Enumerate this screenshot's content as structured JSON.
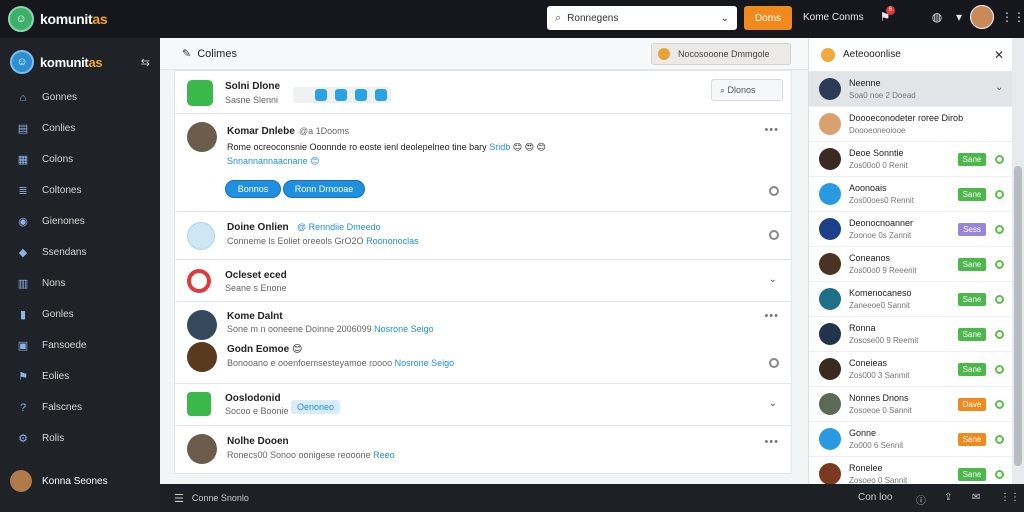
{
  "app": {
    "brand_main": "komunit",
    "brand_accent": "as",
    "side_brand_main": "komunit",
    "side_brand_accent": "as"
  },
  "topbar": {
    "search_value": "Ronnegens",
    "cta_label": "Doms",
    "link_label": "Kome Conms",
    "notif_count": "6"
  },
  "sidebar": {
    "items": [
      {
        "label": "Gonnes",
        "icon": "home-icon"
      },
      {
        "label": "Conlies",
        "icon": "folder-icon"
      },
      {
        "label": "Colons",
        "icon": "grid-icon"
      },
      {
        "label": "Coltones",
        "icon": "list-icon"
      },
      {
        "label": "Gienones",
        "icon": "globe-icon"
      },
      {
        "label": "Ssendans",
        "icon": "drop-icon"
      },
      {
        "label": "Nons",
        "icon": "book-icon"
      },
      {
        "label": "Gonles",
        "icon": "chart-icon"
      },
      {
        "label": "Fansoede",
        "icon": "calendar-icon"
      },
      {
        "label": "Eolies",
        "icon": "flag-icon"
      },
      {
        "label": "Falscnes",
        "icon": "question-icon"
      },
      {
        "label": "Rolis",
        "icon": "network-icon"
      }
    ],
    "user_name": "Konna Seones"
  },
  "main": {
    "title": "Colimes",
    "chip_label": "Nocosooone Dmmgole",
    "group": {
      "name": "Solni Dlone",
      "sub": "Sasne Slenni",
      "search_label": "Dlonos"
    },
    "post1": {
      "name": "Komar Dnlebe",
      "meta": "@a 1Dooms",
      "body": "Rome ocreoconsnie Ooonnde ro eoste ienl deolepelneo tine bary",
      "body_link": "Sridb",
      "line2": "Snnannannaacnane",
      "btn1": "Bonnos",
      "btn2": "Ronn Drnooae"
    },
    "post2": {
      "name": "Doine Onlien",
      "meta": "@ Renndiie Dmeedo",
      "sub": "Conneme ls Eoliet oreeols GrO2O",
      "link": "Roononoclas"
    },
    "section1": {
      "title": "Ocleset eced",
      "sub": "Seane s Enone"
    },
    "post3": {
      "name": "Kome Dalnt",
      "sub": "Sone m n ooneene Doinne 2006099",
      "link": "Nosrone Seigo",
      "name2": "Godn Eomoe",
      "sub2": "Bonooano e ooenfoemsesteyamoe roooo",
      "link2": "Nosrone Seigo"
    },
    "section2": {
      "title": "Ooslodonid",
      "sub": "Socoo e Boonie",
      "tag": "Oenoneo"
    },
    "post4": {
      "name": "Nolhe Dooen",
      "sub": "Ronecs00 Sonoo oonigese reooone",
      "link": "Reeo"
    }
  },
  "rpanel": {
    "title": "Aeteooonlise",
    "rows": [
      {
        "name": "Neenne",
        "sub": "Soa0 noe 2 Doead",
        "btn": "",
        "avatar": "#2b3b55",
        "selected": true
      },
      {
        "name": "Doooeconodeter roree Dirob",
        "sub": "Doooeoneoiooe",
        "btn": "",
        "avatar": "#d9a070",
        "selected": false
      },
      {
        "name": "Deoe Sonntie",
        "sub": "Zos00o0 0 Renit",
        "btn": "Sane",
        "btn_color": "#4cb84a",
        "avatar": "#3b2a24",
        "selected": false
      },
      {
        "name": "Aoonoais",
        "sub": "Zos00oes0 Rennit",
        "btn": "Sane",
        "btn_color": "#4cb84a",
        "avatar": "#2a9ae0",
        "selected": false
      },
      {
        "name": "Deonocnoanner",
        "sub": "Zoonoe 0s Zannit",
        "btn": "Sess",
        "btn_color": "#9a86d6",
        "avatar": "#1e3f8a",
        "selected": false
      },
      {
        "name": "Coneanos",
        "sub": "Zos00o0 9 Reeenit",
        "btn": "Sane",
        "btn_color": "#4cb84a",
        "avatar": "#4a3322",
        "selected": false
      },
      {
        "name": "Komenocaneso",
        "sub": "Zaneeoe0 Sannit",
        "btn": "Sane",
        "btn_color": "#4cb84a",
        "avatar": "#1d6f8a",
        "selected": false
      },
      {
        "name": "Ronna",
        "sub": "Zosose00 9 Reemit",
        "btn": "Sane",
        "btn_color": "#4cb84a",
        "avatar": "#22344d",
        "selected": false
      },
      {
        "name": "Coneieas",
        "sub": "Zos000 3 Sanmit",
        "btn": "Sane",
        "btn_color": "#4cb84a",
        "avatar": "#3a2a20",
        "selected": false
      },
      {
        "name": "Nonnes Dnons",
        "sub": "Zosoeoe 0 Sannit",
        "btn": "Dave",
        "btn_color": "#f08a1c",
        "avatar": "#5a6a55",
        "selected": false
      },
      {
        "name": "Gonne",
        "sub": "Zo000 6 Sennit",
        "btn": "Sane",
        "btn_color": "#f08a1c",
        "avatar": "#2a9ae0",
        "selected": false
      },
      {
        "name": "Ronelee",
        "sub": "Zosoeo 0 Sannit",
        "btn": "Sane",
        "btn_color": "#4cb84a",
        "avatar": "#7a3a22",
        "selected": false
      }
    ]
  },
  "bottombar": {
    "label": "Conne Snonlo",
    "right_label": "Con loo"
  }
}
